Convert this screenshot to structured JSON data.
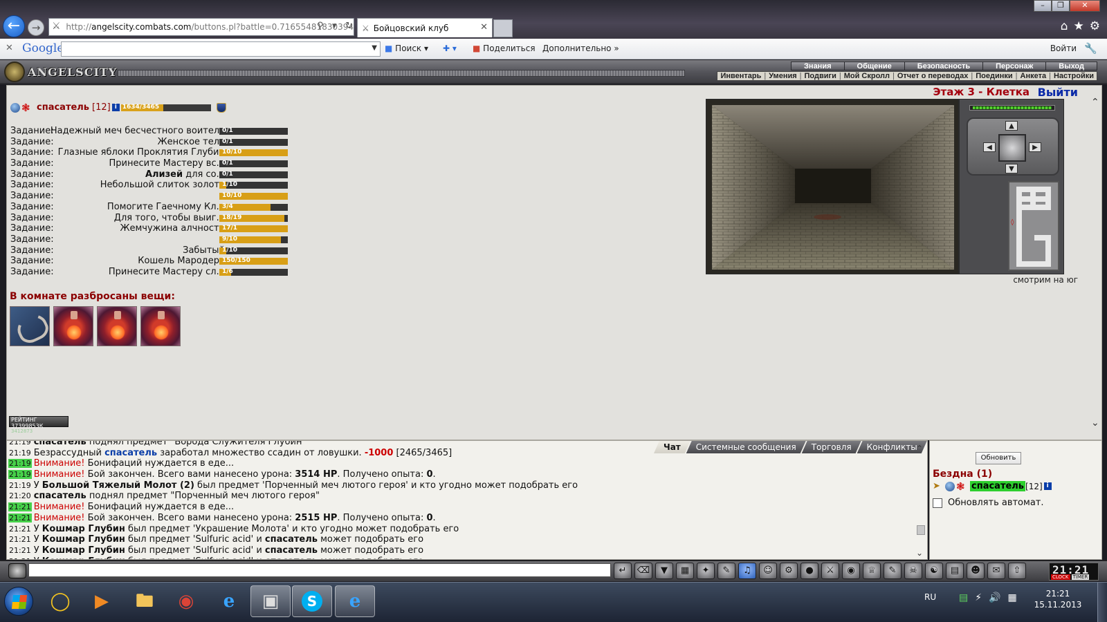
{
  "browser": {
    "url_prefix": "http://",
    "url_host": "angelscity.combats.com",
    "url_rest": "/buttons.pl?battle=0.71655481830394",
    "tab_title": "Бойцовский клуб",
    "google_logo": "Google",
    "search_label": "Поиск",
    "share_label": "Поделиться",
    "more_label": "Дополнительно",
    "login_label": "Войти"
  },
  "header": {
    "logo_text": "ANGELSCITY",
    "top_nav": [
      "Знания",
      "Общение",
      "Безопасность",
      "Персонаж",
      "Выход"
    ],
    "sub_nav": [
      "Инвентарь",
      "Умения",
      "Подвиги",
      "Мой Скролл",
      "Отчет о переводах",
      "Поединки",
      "Анкета",
      "Настройки"
    ]
  },
  "character": {
    "name": "спасатель",
    "level": "[12]",
    "info_badge": "i",
    "hp_text": "1634/3465",
    "hp_fraction": 0.4716
  },
  "quests": {
    "label": "Задание:",
    "rows": [
      {
        "name": "Надежный меч бесчестного воителя",
        "bold": "",
        "progress": "0/1",
        "fraction": 0
      },
      {
        "name": "Женское тело",
        "bold": "",
        "progress": "0/1",
        "fraction": 0
      },
      {
        "name": "Глазные яблоки Проклятия Глубин",
        "bold": "",
        "progress": "10/10",
        "fraction": 1
      },
      {
        "name": "Принесите Мастеру вс...",
        "bold": "",
        "progress": "0/1",
        "fraction": 0
      },
      {
        "name": " для со...",
        "bold": "Ализей",
        "progress": "0/1",
        "fraction": 0
      },
      {
        "name": "Небольшой слиток золота",
        "bold": "",
        "progress": "1/10",
        "fraction": 0.1
      },
      {
        "name": "",
        "bold": "",
        "progress": "10/10",
        "fraction": 1
      },
      {
        "name": "Помогите Гаечному Кл...",
        "bold": "",
        "progress": "3/4",
        "fraction": 0.75
      },
      {
        "name": "Для того, чтобы выиг...",
        "bold": "",
        "progress": "18/19",
        "fraction": 0.947
      },
      {
        "name": "Жемчужина алчности",
        "bold": "",
        "progress": "17/1",
        "fraction": 1
      },
      {
        "name": "",
        "bold": "",
        "progress": "9/10",
        "fraction": 0.9
      },
      {
        "name": "Забытый",
        "bold": "",
        "progress": "1/10",
        "fraction": 0.1
      },
      {
        "name": "Кошель Мародера",
        "bold": "",
        "progress": "150/150",
        "fraction": 1
      },
      {
        "name": "Принесите Мастеру сл...",
        "bold": "",
        "progress": "1/6",
        "fraction": 0.167
      }
    ]
  },
  "room_items": {
    "title": "В комнате разбросаны вещи:",
    "items": [
      "beard",
      "potion",
      "potion",
      "potion"
    ]
  },
  "rating": {
    "label": "РЕЙТИНГ 37399853К",
    "sub": "3412873"
  },
  "location": {
    "title": "Этаж 3 - Клетка",
    "exit_label": "Выйти",
    "facing": "смотрим на юг"
  },
  "chat": {
    "tabs": [
      "Чат",
      "Системные сообщения",
      "Торговля",
      "Конфликты"
    ],
    "partial_line": {
      "time": "21:19",
      "actor": "спасатель",
      "text": " поднял предмет \"Борода Служителя Глубин\""
    },
    "lines": [
      {
        "time": "21:19",
        "hl": false,
        "pre": "Безрассудный ",
        "actor": "спасатель",
        "text": " заработал множество ссадин от ловушки. ",
        "dmg": "-1000",
        "post": " [2465/3465]"
      },
      {
        "time": "21:19",
        "hl": true,
        "warn": "Внимание!",
        "text": " Бонифаций нуждается в еде..."
      },
      {
        "time": "21:19",
        "hl": true,
        "warn": "Внимание!",
        "text": " Бой закончен. Всего вами нанесено урона: ",
        "b1": "3514 HP",
        "text2": ". Получено опыта: ",
        "b2": "0",
        "text3": "."
      },
      {
        "time": "21:19",
        "hl": false,
        "pre": "У ",
        "b1": "Большой Тяжелый Молот (2)",
        "text": " был предмет 'Порченный меч лютого героя' и кто угодно может подобрать его"
      },
      {
        "time": "21:20",
        "hl": false,
        "b1": "спасатель",
        "text": " поднял предмет \"Порченный меч лютого героя\""
      },
      {
        "time": "21:21",
        "hl": true,
        "warn": "Внимание!",
        "text": " Бонифаций нуждается в еде..."
      },
      {
        "time": "21:21",
        "hl": true,
        "warn": "Внимание!",
        "text": " Бой закончен. Всего вами нанесено урона: ",
        "b1": "2515 HP",
        "text2": ". Получено опыта: ",
        "b2": "0",
        "text3": "."
      },
      {
        "time": "21:21",
        "hl": false,
        "pre": "У ",
        "b1": "Кошмар Глубин",
        "text": " был предмет 'Украшение Молота' и кто угодно может подобрать его"
      },
      {
        "time": "21:21",
        "hl": false,
        "pre": "У ",
        "b1": "Кошмар Глубин",
        "text": " был предмет 'Sulfuric acid' и ",
        "b2": "спасатель",
        "text2": " может подобрать его"
      },
      {
        "time": "21:21",
        "hl": false,
        "pre": "У ",
        "b1": "Кошмар Глубин",
        "text": " был предмет 'Sulfuric acid' и ",
        "b2": "спасатель",
        "text2": " может подобрать его"
      },
      {
        "time": "21:21",
        "hl": false,
        "pre": "У ",
        "b1": "Кошмар Глубин",
        "text": " был предмет 'Sulfuric acid' и ",
        "b2": "спасатель",
        "text2": " может подобрать его"
      }
    ]
  },
  "room_panel": {
    "refresh_label": "Обновить",
    "room_name": "Бездна (1)",
    "user_name": "спасатель",
    "user_level": "[12]",
    "info_badge": "i",
    "auto_refresh_label": "Обновлять автомат."
  },
  "clock": {
    "digits": "21:21",
    "label_clock": "CLOCK",
    "label_timer": "TIMER"
  },
  "taskbar": {
    "lang": "RU",
    "time": "21:21",
    "date": "15.11.2013"
  },
  "colors": {
    "quest_bar_fill": "#d89f16",
    "quest_bar_empty": "#343434",
    "title_red": "#8b0000",
    "exit_blue": "#0b2aa8",
    "chat_highlight": "#46d14a"
  }
}
